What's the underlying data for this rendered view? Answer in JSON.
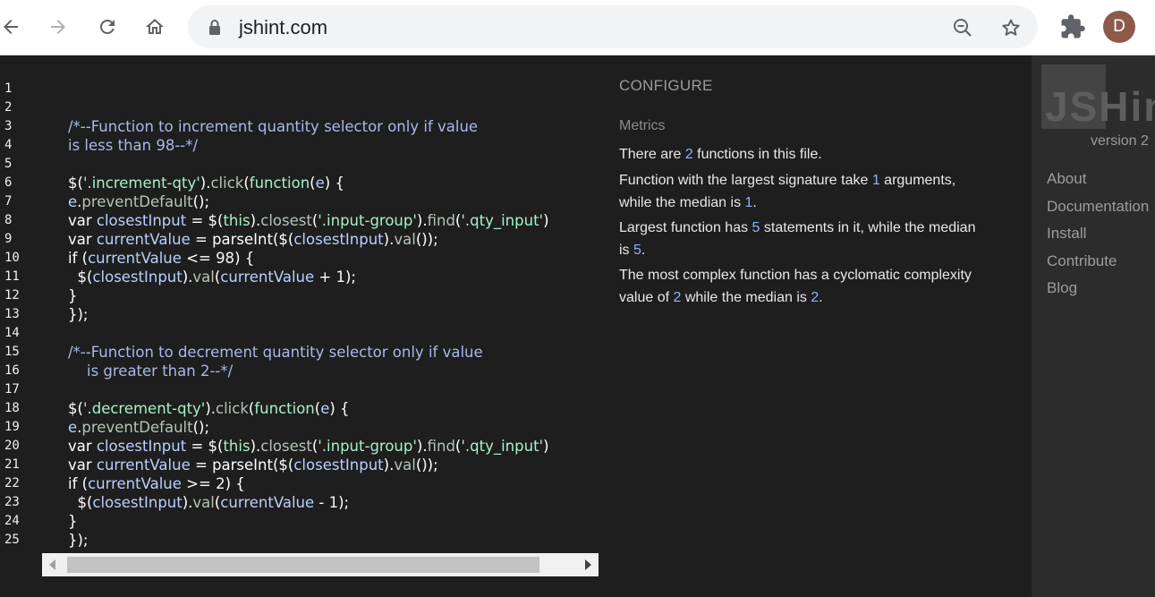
{
  "browser": {
    "url": "jshint.com",
    "avatar_letter": "D",
    "avatar_color": "#8d5a4a"
  },
  "editor": {
    "line_numbers": [
      "1",
      "2",
      "3",
      "4",
      "5",
      "6",
      "7",
      "8",
      "9",
      "10",
      "11",
      "12",
      "13",
      "14",
      "15",
      "16",
      "17",
      "18",
      "19",
      "20",
      "21",
      "22",
      "23",
      "24",
      "25"
    ],
    "lines": [
      [],
      [],
      [
        [
          "cm",
          "/*--Function to increment quantity selector only if value"
        ]
      ],
      [
        [
          "cm",
          "is less than 98--*/"
        ]
      ],
      [],
      [
        [
          "kw",
          "$("
        ],
        [
          "st",
          "'.increment-qty'"
        ],
        [
          "kw",
          ")."
        ],
        [
          "fn",
          "click"
        ],
        [
          "kw",
          "("
        ],
        [
          "st",
          "function"
        ],
        [
          "kw",
          "("
        ],
        [
          "vr",
          "e"
        ],
        [
          "kw",
          ") {"
        ]
      ],
      [
        [
          "vr",
          "e"
        ],
        [
          "kw",
          "."
        ],
        [
          "fn",
          "preventDefault"
        ],
        [
          "kw",
          "();"
        ]
      ],
      [
        [
          "kw",
          "var "
        ],
        [
          "vr",
          "closestInput"
        ],
        [
          "kw",
          " = $("
        ],
        [
          "st",
          "this"
        ],
        [
          "kw",
          ")."
        ],
        [
          "fn",
          "closest"
        ],
        [
          "kw",
          "("
        ],
        [
          "st",
          "'.input-group'"
        ],
        [
          "kw",
          ")."
        ],
        [
          "fn",
          "find"
        ],
        [
          "kw",
          "("
        ],
        [
          "st",
          "'.qty_input'"
        ],
        [
          "kw",
          ")"
        ]
      ],
      [
        [
          "kw",
          "var "
        ],
        [
          "vr",
          "currentValue"
        ],
        [
          "kw",
          " = parseInt($("
        ],
        [
          "vr",
          "closestInput"
        ],
        [
          "kw",
          ")."
        ],
        [
          "fn",
          "val"
        ],
        [
          "kw",
          "());"
        ]
      ],
      [
        [
          "kw",
          "if ("
        ],
        [
          "vr",
          "currentValue"
        ],
        [
          "kw",
          " <= "
        ],
        [
          "nm",
          "98"
        ],
        [
          "kw",
          ") {"
        ]
      ],
      [
        [
          "kw",
          "  $("
        ],
        [
          "vr",
          "closestInput"
        ],
        [
          "kw",
          ")."
        ],
        [
          "fn",
          "val"
        ],
        [
          "kw",
          "("
        ],
        [
          "vr",
          "currentValue"
        ],
        [
          "kw",
          " + "
        ],
        [
          "nm",
          "1"
        ],
        [
          "kw",
          ");"
        ]
      ],
      [
        [
          "kw",
          "}"
        ]
      ],
      [
        [
          "kw",
          "});"
        ]
      ],
      [],
      [
        [
          "cm",
          "/*--Function to decrement quantity selector only if value"
        ]
      ],
      [
        [
          "cm",
          "    is greater than 2--*/"
        ]
      ],
      [],
      [
        [
          "kw",
          "$("
        ],
        [
          "st",
          "'.decrement-qty'"
        ],
        [
          "kw",
          ")."
        ],
        [
          "fn",
          "click"
        ],
        [
          "kw",
          "("
        ],
        [
          "st",
          "function"
        ],
        [
          "kw",
          "("
        ],
        [
          "vr",
          "e"
        ],
        [
          "kw",
          ") {"
        ]
      ],
      [
        [
          "vr",
          "e"
        ],
        [
          "kw",
          "."
        ],
        [
          "fn",
          "preventDefault"
        ],
        [
          "kw",
          "();"
        ]
      ],
      [
        [
          "kw",
          "var "
        ],
        [
          "vr",
          "closestInput"
        ],
        [
          "kw",
          " = $("
        ],
        [
          "st",
          "this"
        ],
        [
          "kw",
          ")."
        ],
        [
          "fn",
          "closest"
        ],
        [
          "kw",
          "("
        ],
        [
          "st",
          "'.input-group'"
        ],
        [
          "kw",
          ")."
        ],
        [
          "fn",
          "find"
        ],
        [
          "kw",
          "("
        ],
        [
          "st",
          "'.qty_input'"
        ],
        [
          "kw",
          ")"
        ]
      ],
      [
        [
          "kw",
          "var "
        ],
        [
          "vr",
          "currentValue"
        ],
        [
          "kw",
          " = parseInt($("
        ],
        [
          "vr",
          "closestInput"
        ],
        [
          "kw",
          ")."
        ],
        [
          "fn",
          "val"
        ],
        [
          "kw",
          "());"
        ]
      ],
      [
        [
          "kw",
          "if ("
        ],
        [
          "vr",
          "currentValue"
        ],
        [
          "kw",
          " >= "
        ],
        [
          "nm",
          "2"
        ],
        [
          "kw",
          ") {"
        ]
      ],
      [
        [
          "kw",
          "  $("
        ],
        [
          "vr",
          "closestInput"
        ],
        [
          "kw",
          ")."
        ],
        [
          "fn",
          "val"
        ],
        [
          "kw",
          "("
        ],
        [
          "vr",
          "currentValue"
        ],
        [
          "kw",
          " - "
        ],
        [
          "nm",
          "1"
        ],
        [
          "kw",
          ");"
        ]
      ],
      [
        [
          "kw",
          "}"
        ]
      ],
      [
        [
          "kw",
          "});"
        ]
      ]
    ]
  },
  "report": {
    "configure": "CONFIGURE",
    "metrics_heading": "Metrics",
    "metrics": [
      [
        [
          "t",
          "There are "
        ],
        [
          "n",
          "2"
        ],
        [
          "t",
          " functions in this file."
        ]
      ],
      [
        [
          "t",
          "Function with the largest signature take "
        ],
        [
          "n",
          "1"
        ],
        [
          "t",
          " arguments, while the median is "
        ],
        [
          "n",
          "1"
        ],
        [
          "t",
          "."
        ]
      ],
      [
        [
          "t",
          "Largest function has "
        ],
        [
          "n",
          "5"
        ],
        [
          "t",
          " statements in it, while the median is "
        ],
        [
          "n",
          "5"
        ],
        [
          "t",
          "."
        ]
      ],
      [
        [
          "t",
          "The most complex function has a cyclomatic complexity value of "
        ],
        [
          "n",
          "2"
        ],
        [
          "t",
          " while the median is "
        ],
        [
          "n",
          "2"
        ],
        [
          "t",
          "."
        ]
      ]
    ]
  },
  "sidebar": {
    "logo_text": "JSHint",
    "version": "version 2",
    "links": [
      "About",
      "Documentation",
      "Install",
      "Contribute",
      "Blog"
    ]
  }
}
